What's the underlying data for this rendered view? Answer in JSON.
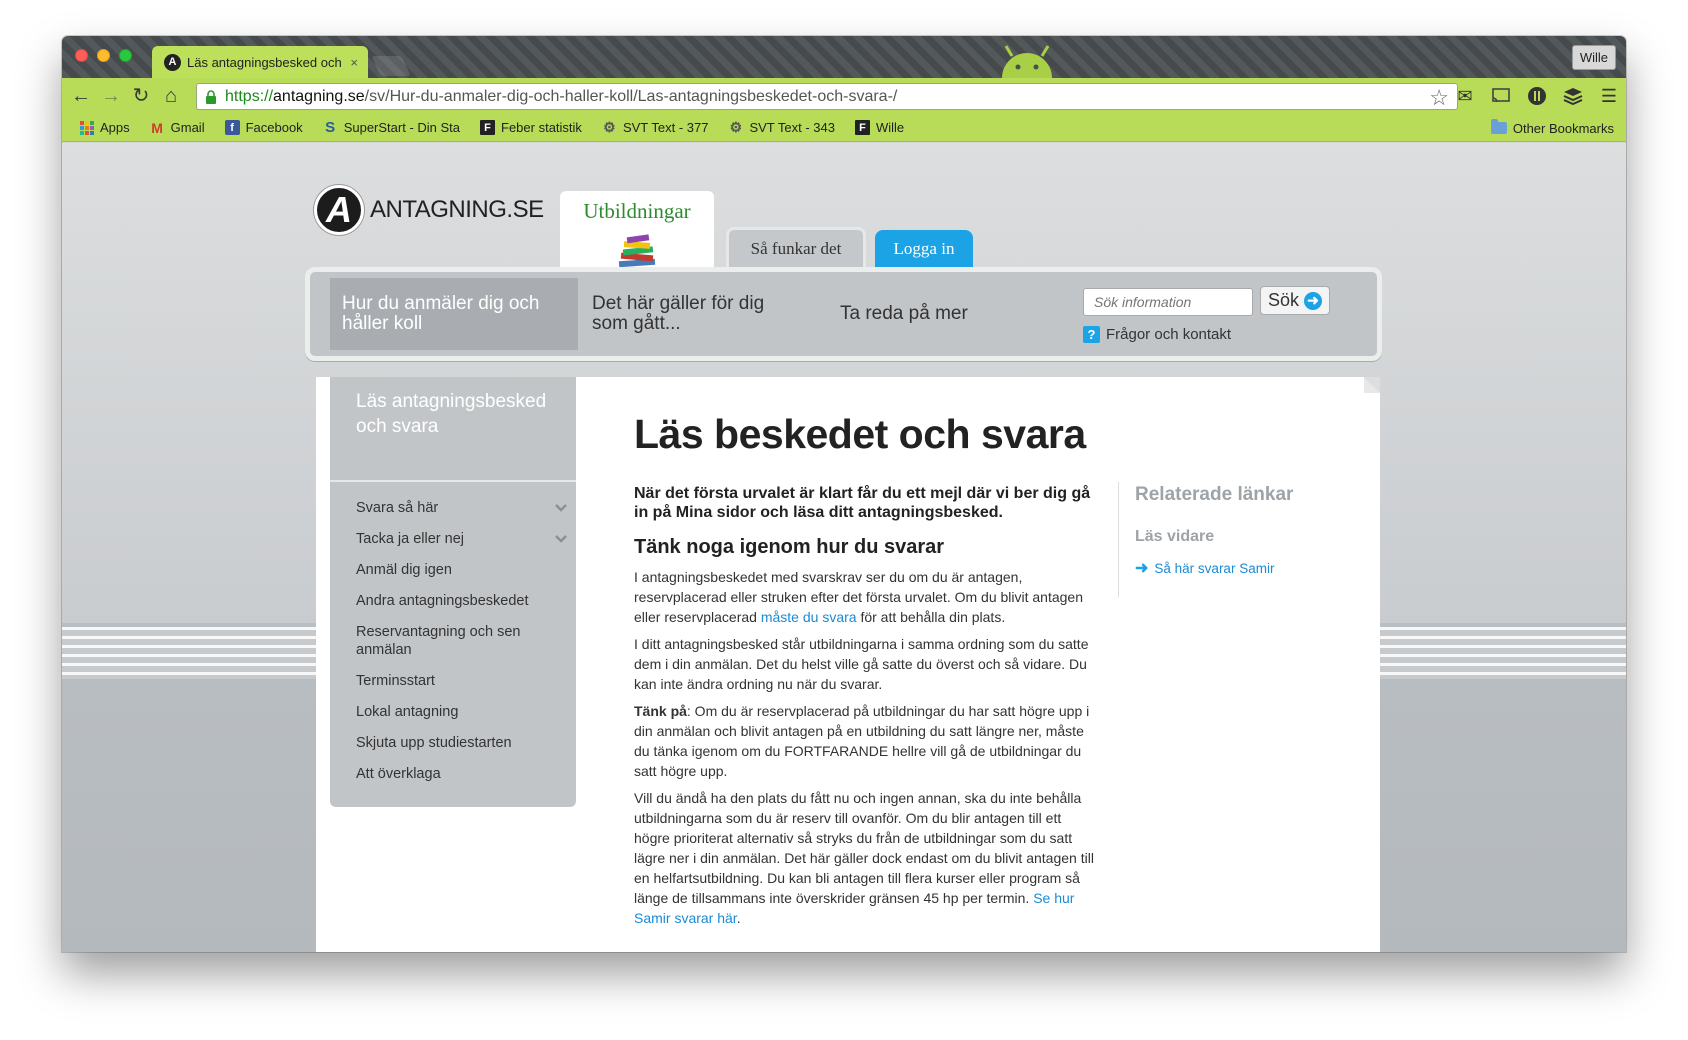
{
  "browser": {
    "tab_title": "Läs antagningsbesked och",
    "tab_close": "×",
    "profile_name": "Wille",
    "url_scheme": "https://",
    "url_host": "antagning.se",
    "url_path": "/sv/Hur-du-anmaler-dig-och-haller-koll/Las-antagningsbeskedet-och-svara-/",
    "bookmarks": [
      {
        "label": "Apps",
        "icon": "apps-grid-icon"
      },
      {
        "label": "Gmail",
        "icon": "gmail-icon"
      },
      {
        "label": "Facebook",
        "icon": "facebook-icon"
      },
      {
        "label": "SuperStart - Din Sta",
        "icon": "superstart-icon"
      },
      {
        "label": "Feber statistik",
        "icon": "feber-icon"
      },
      {
        "label": "SVT Text - 377",
        "icon": "gear-icon"
      },
      {
        "label": "SVT Text - 343",
        "icon": "gear-icon"
      },
      {
        "label": "Wille",
        "icon": "feber-icon"
      }
    ],
    "other_bookmarks": "Other Bookmarks",
    "toolbar_color": "#b8dc58"
  },
  "site": {
    "logo_letter": "A",
    "logo_text": "ANTAGNING.SE",
    "top_tabs": {
      "utbildningar": "Utbildningar",
      "sa_funkar": "Så funkar det",
      "logga_in": "Logga in"
    },
    "nav": {
      "item1": "Hur du anmäler dig och håller koll",
      "item2": "Det här gäller för dig som gått...",
      "item3": "Ta reda på mer"
    },
    "search": {
      "placeholder": "Sök information",
      "button": "Sök"
    },
    "faq": "Frågor och kontakt",
    "accent": "#1ba3e6"
  },
  "sidebar": {
    "heading": "Läs antagningsbesked och svara",
    "items": [
      {
        "label": "Svara så här",
        "expandable": true
      },
      {
        "label": "Tacka ja eller nej",
        "expandable": true
      },
      {
        "label": "Anmäl dig igen"
      },
      {
        "label": "Andra antagningsbeskedet"
      },
      {
        "label": "Reservantagning och sen anmälan"
      },
      {
        "label": "Terminsstart"
      },
      {
        "label": "Lokal antagning"
      },
      {
        "label": "Skjuta upp studiestarten"
      },
      {
        "label": "Att överklaga"
      }
    ]
  },
  "article": {
    "title": "Läs beskedet och svara",
    "lead": "När det första urvalet är klart får du ett mejl där vi ber dig gå in på Mina sidor och läsa ditt antagningsbesked.",
    "subheading": "Tänk noga igenom hur du svarar",
    "p1_a": "I antagningsbeskedet med svarskrav ser du om du är antagen, reservplacerad eller struken efter det första urvalet. Om du blivit antagen eller reservplacerad ",
    "p1_link": "måste du svara",
    "p1_b": " för att behålla din plats.",
    "p2": "I ditt antagningsbesked står utbildningarna i samma ordning som du satte dem i din anmälan. Det du helst ville gå satte du överst och så vidare. Du kan inte ändra ordning nu när du svarar.",
    "p3_bold": "Tänk på",
    "p3": ": Om du är reservplacerad på utbildningar du har satt högre upp i din anmälan och blivit antagen på en utbildning du satt längre ner, måste du tänka igenom om du FORTFARANDE hellre vill gå de utbildningar du satt högre upp.",
    "p4": "Vill du ändå ha den plats du fått nu och ingen annan, ska du inte behålla utbildningarna som du är reserv till ovanför. Om du blir antagen till ett högre prioriterat alternativ så stryks du från de utbildningar som du satt lägre ner i din anmälan. Det här gäller dock endast om du blivit antagen till en helfartsutbildning. Du kan bli antagen till flera kurser eller program så länge de tillsammans inte överskrider gränsen 45 hp per termin. ",
    "p4_link": "Se hur Samir svarar här",
    "p4_end": "."
  },
  "related": {
    "title": "Relaterade länkar",
    "subtitle": "Läs vidare",
    "link": "Så här svarar Samir"
  }
}
